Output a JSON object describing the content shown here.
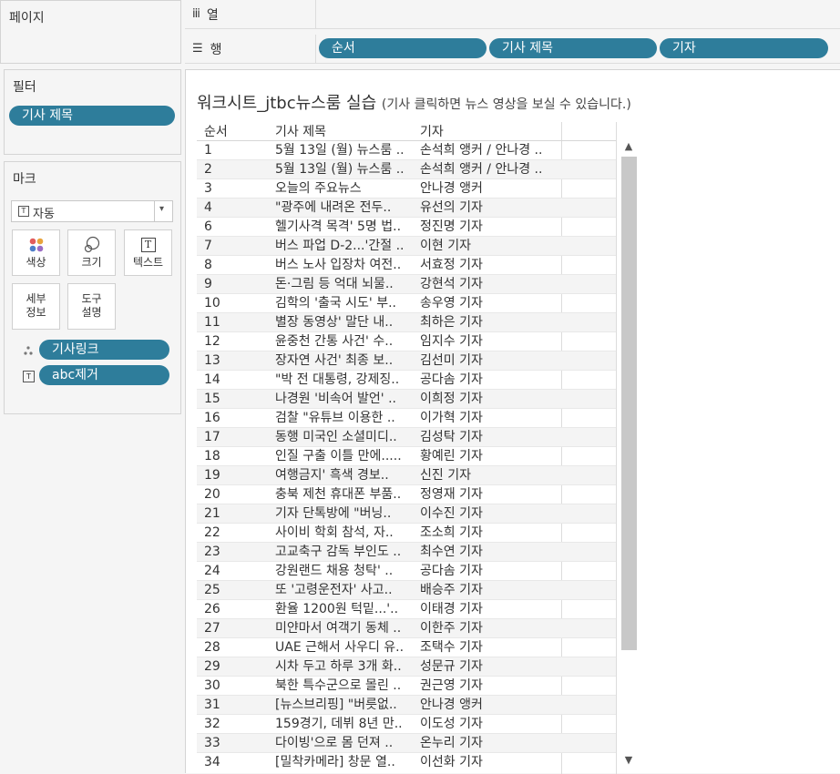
{
  "pages_panel": {
    "title": "페이지"
  },
  "columns_shelf": {
    "label": "열",
    "icon": "columns-icon"
  },
  "rows_shelf": {
    "label": "행",
    "icon": "rows-icon",
    "pills": [
      "순서",
      "기사 제목",
      "기자"
    ]
  },
  "filters_panel": {
    "title": "필터",
    "pills": [
      "기사 제목"
    ]
  },
  "marks_panel": {
    "title": "마크",
    "mark_type": "자동",
    "cards": [
      {
        "label": "색상",
        "icon": "color-icon"
      },
      {
        "label": "크기",
        "icon": "size-icon"
      },
      {
        "label": "텍스트",
        "icon": "text-icon"
      },
      {
        "label": "세부\n정보",
        "icon": "detail-icon"
      },
      {
        "label": "도구\n설명",
        "icon": "tooltip-icon"
      }
    ],
    "fields": [
      {
        "label": "기사링크",
        "icon": "detail-dots-icon"
      },
      {
        "label": "abc제거",
        "icon": "text-small-icon"
      }
    ]
  },
  "worksheet": {
    "title": "워크시트_jtbc뉴스룸 실습",
    "subtitle": "(기사 클릭하면 뉴스 영상을 보실 수 있습니다.)",
    "headers": [
      "순서",
      "기사 제목",
      "기자"
    ],
    "rows": [
      [
        "1",
        "5월 13일 (월) 뉴스룸 ..",
        "손석희 앵커 / 안나경 .."
      ],
      [
        "2",
        "5월 13일 (월) 뉴스룸 ..",
        "손석희 앵커 / 안나경 .."
      ],
      [
        "3",
        "오늘의 주요뉴스",
        "안나경 앵커"
      ],
      [
        "4",
        "\"광주에 내려온 전두..",
        "유선의 기자"
      ],
      [
        "6",
        "헬기사격 목격' 5명 법..",
        "정진명 기자"
      ],
      [
        "7",
        "버스 파업 D-2...'간절 ..",
        "이현 기자"
      ],
      [
        "8",
        "버스 노사 입장차 여전..",
        "서효정 기자"
      ],
      [
        "9",
        "돈·그림 등 억대 뇌물..",
        "강현석 기자"
      ],
      [
        "10",
        "김학의 '출국 시도' 부..",
        "송우영 기자"
      ],
      [
        "11",
        "별장 동영상' 말단 내..",
        "최하은 기자"
      ],
      [
        "12",
        "윤중천 간통 사건' 수..",
        "임지수 기자"
      ],
      [
        "13",
        "장자연 사건' 최종 보..",
        "김선미 기자"
      ],
      [
        "14",
        "\"박 전 대통령, 강제징..",
        "공다솜 기자"
      ],
      [
        "15",
        "나경원 '비속어 발언' ..",
        "이희정 기자"
      ],
      [
        "16",
        "검찰 \"유튜브 이용한 ..",
        "이가혁 기자"
      ],
      [
        "17",
        "동행 미국인 소셜미디..",
        "김성탁 기자"
      ],
      [
        "18",
        "인질 구출 이틀 만에.....",
        "황예린 기자"
      ],
      [
        "19",
        "여행금지' 흑색 경보..",
        "신진 기자"
      ],
      [
        "20",
        "충북 제천 휴대폰 부품..",
        "정영재 기자"
      ],
      [
        "21",
        "기자 단톡방에 \"버닝..",
        "이수진 기자"
      ],
      [
        "22",
        "사이비 학회 참석, 자..",
        "조소희 기자"
      ],
      [
        "23",
        "고교축구 감독 부인도 ..",
        "최수연 기자"
      ],
      [
        "24",
        "강원랜드 채용 청탁' ..",
        "공다솜 기자"
      ],
      [
        "25",
        "또 '고령운전자' 사고..",
        "배승주 기자"
      ],
      [
        "26",
        "환율 1200원 턱밑...'..",
        "이태경 기자"
      ],
      [
        "27",
        "미얀마서 여객기 동체 ..",
        "이한주 기자"
      ],
      [
        "28",
        "UAE 근해서 사우디 유..",
        "조택수 기자"
      ],
      [
        "29",
        "시차 두고 하루 3개 화..",
        "성문규 기자"
      ],
      [
        "30",
        "북한 특수군으로 몰린 ..",
        "권근영 기자"
      ],
      [
        "31",
        "[뉴스브리핑] \"버릇없..",
        "안나경 앵커"
      ],
      [
        "32",
        "159경기, 데뷔 8년 만..",
        "이도성 기자"
      ],
      [
        "33",
        "다이빙'으로 몸 던져 ..",
        "온누리 기자"
      ],
      [
        "34",
        "[밀착카메라] 창문 열..",
        "이선화 기자"
      ]
    ]
  },
  "colors": {
    "pill": "#2e7d9b",
    "panel_bg": "#f5f5f5",
    "scroll_thumb": "#c8c8c8"
  }
}
